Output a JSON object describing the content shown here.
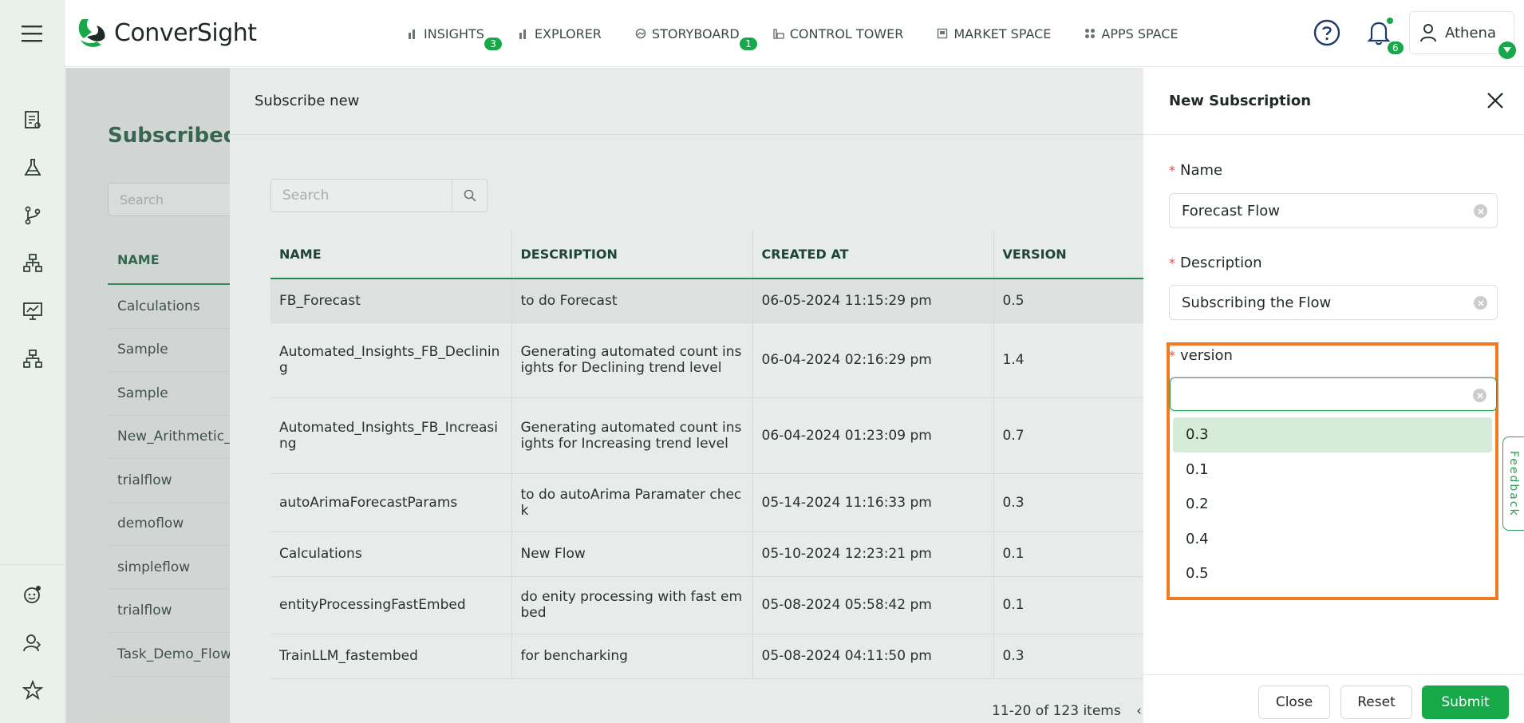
{
  "app": {
    "logo_text": "ConverSight"
  },
  "nav": [
    {
      "label": "INSIGHTS",
      "icon": "bar-chart-icon",
      "badge": "3"
    },
    {
      "label": "EXPLORER",
      "icon": "bar-chart-icon",
      "badge": ""
    },
    {
      "label": "STORYBOARD",
      "icon": "storyboard-icon",
      "badge": "1"
    },
    {
      "label": "CONTROL TOWER",
      "icon": "control-tower-icon",
      "badge": ""
    },
    {
      "label": "MARKET SPACE",
      "icon": "market-icon",
      "badge": ""
    },
    {
      "label": "APPS SPACE",
      "icon": "apps-icon",
      "badge": ""
    }
  ],
  "header": {
    "notification_count": "6",
    "user_name": "Athena"
  },
  "page": {
    "title": "Subscribed F",
    "search_placeholder": "Search",
    "column_name": "NAME",
    "rows": [
      "Calculations",
      "Sample",
      "Sample",
      "New_Arithmetic_",
      "trialflow",
      "demoflow",
      "simpleflow",
      "trialflow",
      "Task_Demo_Flow"
    ]
  },
  "subscribe": {
    "title": "Subscribe new",
    "search_placeholder": "Search",
    "columns": [
      "NAME",
      "DESCRIPTION",
      "CREATED AT",
      "VERSION"
    ],
    "rows": [
      {
        "name": "FB_Forecast",
        "description": "to do Forecast",
        "created": "06-05-2024 11:15:29 pm",
        "version": "0.5"
      },
      {
        "name": "Automated_Insights_FB_Declining",
        "description": "Generating automated count insights for Declining trend level",
        "created": "06-04-2024 02:16:29 pm",
        "version": "1.4"
      },
      {
        "name": "Automated_Insights_FB_Increasing",
        "description": "Generating automated count insights for Increasing trend level",
        "created": "06-04-2024 01:23:09 pm",
        "version": "0.7"
      },
      {
        "name": "autoArimaForecastParams",
        "description": "to do autoArima Paramater check",
        "created": "05-14-2024 11:16:33 pm",
        "version": "0.3"
      },
      {
        "name": "Calculations",
        "description": "New Flow",
        "created": "05-10-2024 12:23:21 pm",
        "version": "0.1"
      },
      {
        "name": "entityProcessingFastEmbed",
        "description": "do enity processing with fast embed",
        "created": "05-08-2024 05:58:42 pm",
        "version": "0.1"
      },
      {
        "name": "TrainLLM_fastembed",
        "description": "for bencharking",
        "created": "05-08-2024 04:11:50 pm",
        "version": "0.3"
      }
    ],
    "pagination": "11-20 of 123 items"
  },
  "drawer": {
    "title": "New Subscription",
    "name_label": "Name",
    "name_value": "Forecast Flow",
    "description_label": "Description",
    "description_value": "Subscribing the Flow",
    "version_label": "version",
    "version_value": "",
    "version_options": [
      "0.3",
      "0.1",
      "0.2",
      "0.4",
      "0.5"
    ],
    "close_label": "Close",
    "reset_label": "Reset",
    "submit_label": "Submit",
    "feedback_label": "Feedback"
  },
  "colors": {
    "accent": "#17a84a",
    "highlight": "#f07a22",
    "title_green": "#1f5a40"
  }
}
